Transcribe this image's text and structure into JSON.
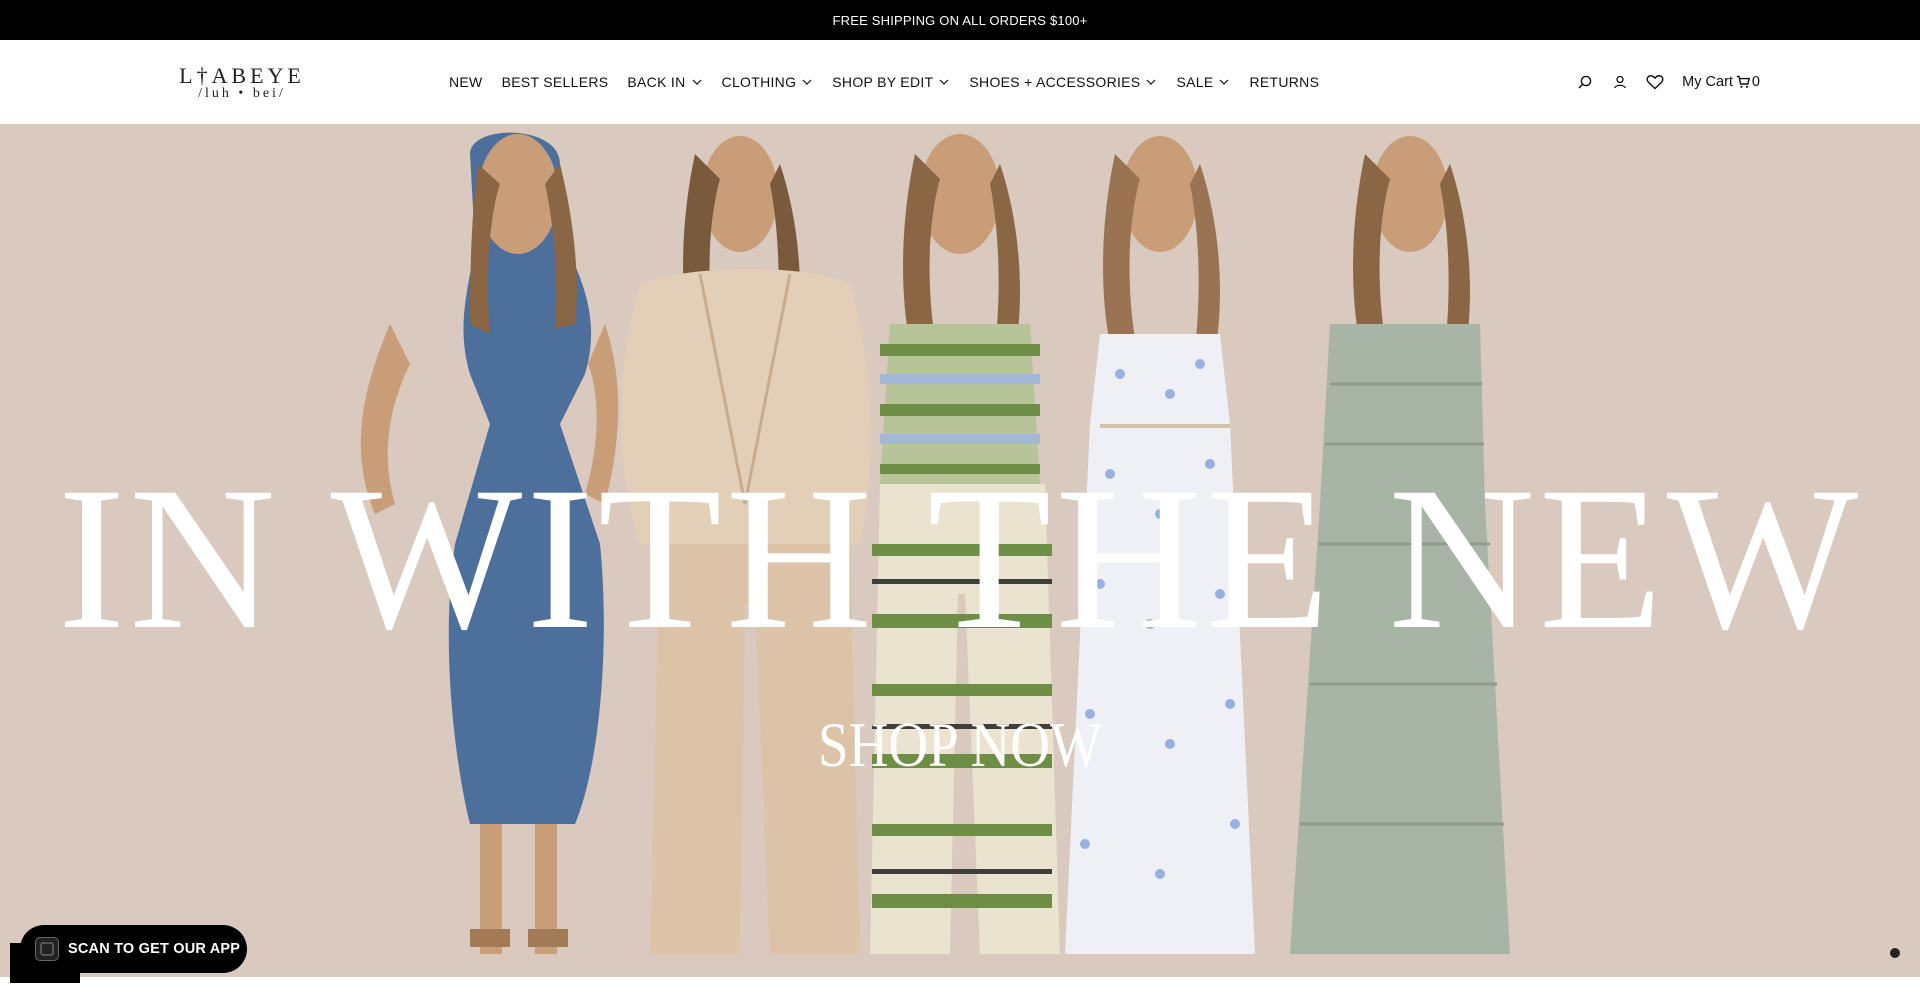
{
  "announcement": {
    "text": "FREE SHIPPING ON ALL ORDERS $100+"
  },
  "logo": {
    "main": "L†ABEYE",
    "sub": "/luh • bei/"
  },
  "nav": {
    "items": [
      {
        "label": "NEW",
        "dropdown": false
      },
      {
        "label": "BEST SELLERS",
        "dropdown": false
      },
      {
        "label": "BACK IN",
        "dropdown": true
      },
      {
        "label": "CLOTHING",
        "dropdown": true
      },
      {
        "label": "SHOP BY EDIT",
        "dropdown": true
      },
      {
        "label": "SHOES + ACCESSORIES",
        "dropdown": true
      },
      {
        "label": "SALE",
        "dropdown": true
      },
      {
        "label": "RETURNS",
        "dropdown": false
      }
    ]
  },
  "utils": {
    "icons": [
      "search-icon",
      "account-icon",
      "wishlist-heart-icon"
    ],
    "cart_label": "My Cart",
    "cart_count": "0"
  },
  "hero": {
    "headline": "IN WITH THE NEW",
    "cta": "SHOP NOW",
    "background_color": "#d9c9bf"
  },
  "app_badge": {
    "label": "SCAN TO GET OUR APP"
  },
  "colors": {
    "announcement_bg": "#000000",
    "text": "#111111",
    "hero_text": "#ffffff"
  }
}
